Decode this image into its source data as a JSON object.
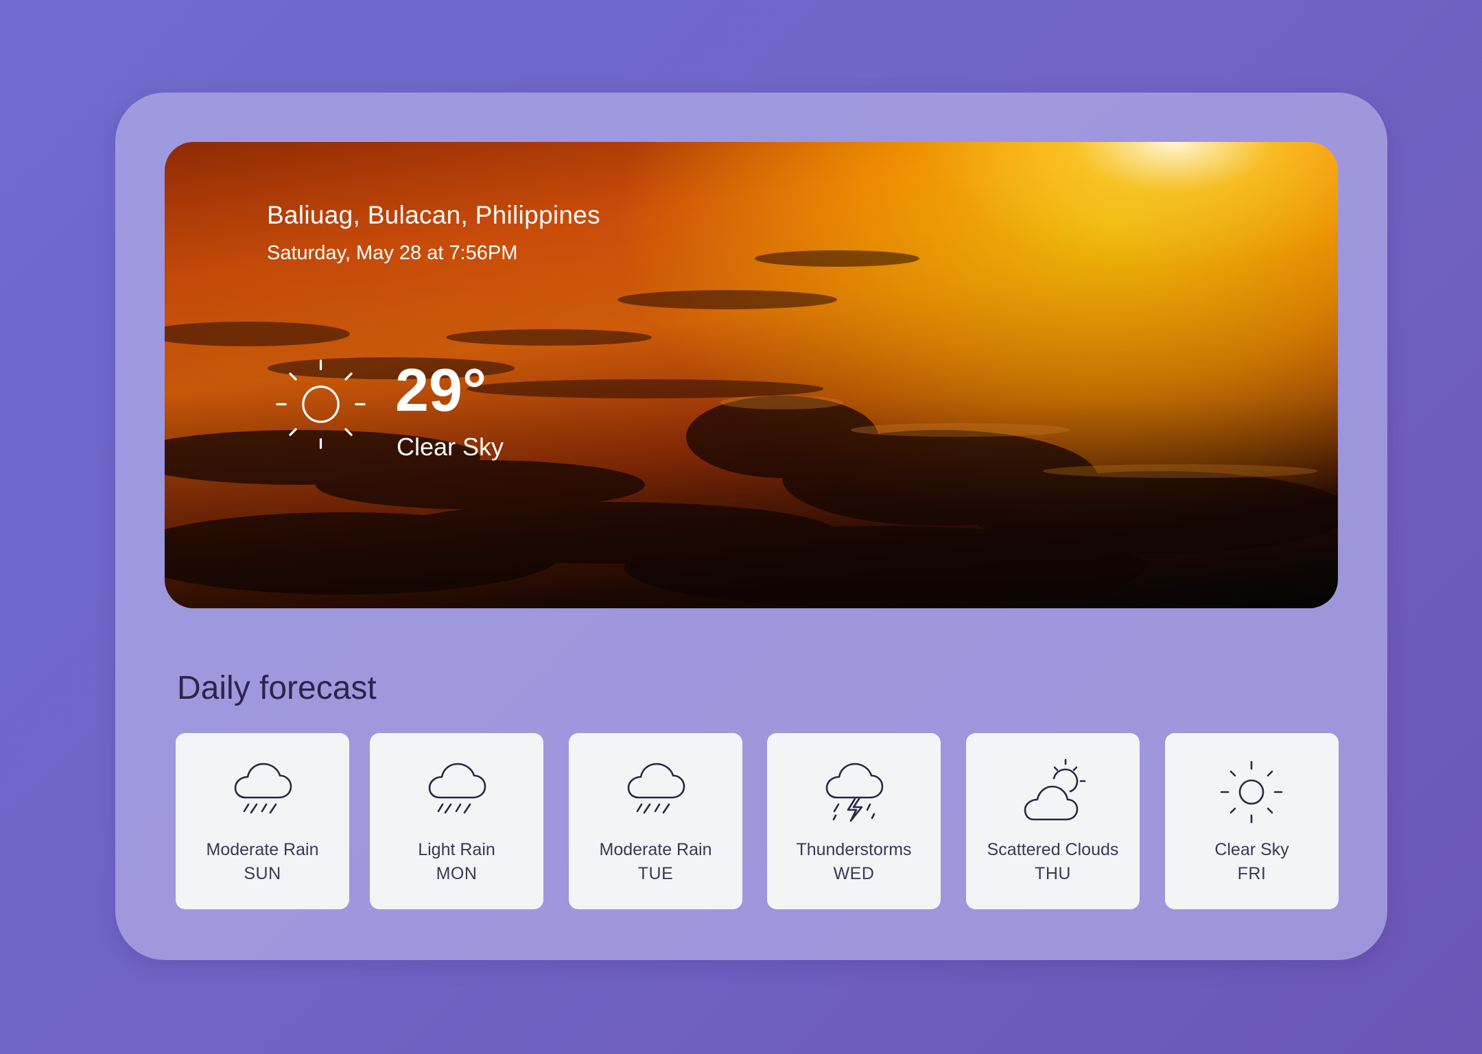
{
  "weather": {
    "location": "Baliuag, Bulacan, Philippines",
    "datetime": "Saturday, May 28 at 7:56PM",
    "temperature": "29°",
    "condition": "Clear Sky",
    "icon": "sun-icon"
  },
  "forecast": {
    "title": "Daily forecast",
    "days": [
      {
        "condition": "Moderate Rain",
        "day": "SUN",
        "icon": "rain-cloud-icon"
      },
      {
        "condition": "Light Rain",
        "day": "MON",
        "icon": "rain-cloud-icon"
      },
      {
        "condition": "Moderate Rain",
        "day": "TUE",
        "icon": "rain-cloud-icon"
      },
      {
        "condition": "Thunderstorms",
        "day": "WED",
        "icon": "thunderstorm-icon"
      },
      {
        "condition": "Scattered Clouds",
        "day": "THU",
        "icon": "partly-cloudy-icon"
      },
      {
        "condition": "Clear Sky",
        "day": "FRI",
        "icon": "sun-icon"
      }
    ]
  },
  "colors": {
    "background": "#6f62c4",
    "card": "#9b93d8",
    "forecast_card": "#f3f4f6",
    "text_dark": "#2a254a"
  }
}
